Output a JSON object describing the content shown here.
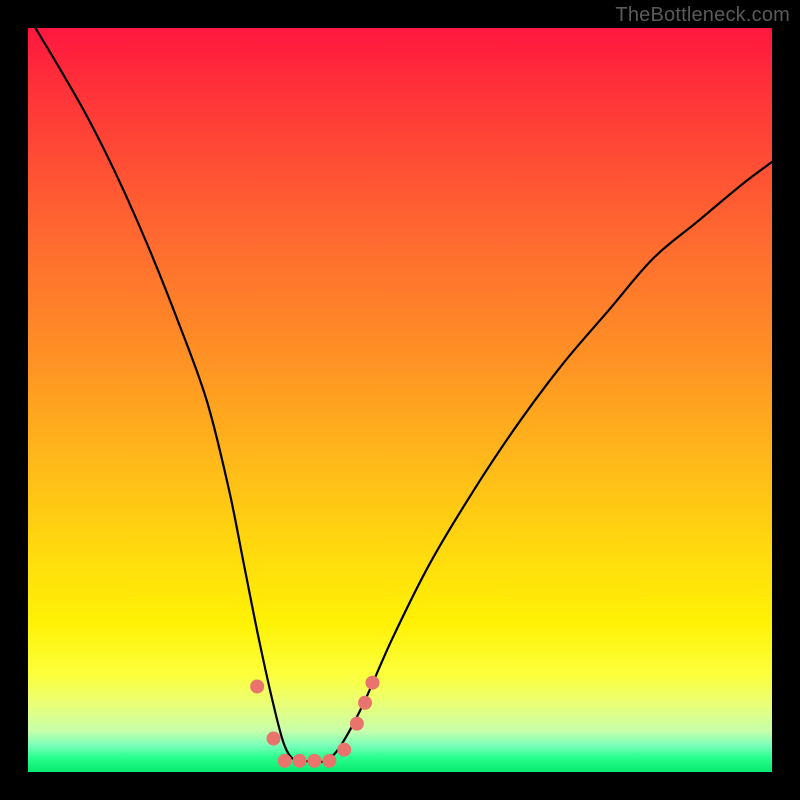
{
  "watermark": "TheBottleneck.com",
  "chart_data": {
    "type": "line",
    "title": "",
    "xlabel": "",
    "ylabel": "",
    "xlim": [
      0,
      100
    ],
    "ylim": [
      0,
      100
    ],
    "series": [
      {
        "name": "bottleneck-curve",
        "x": [
          1,
          4,
          8,
          12,
          16,
          20,
          24,
          27,
          29,
          31,
          33,
          34.5,
          36,
          38,
          40,
          42,
          45,
          49,
          54,
          60,
          66,
          72,
          78,
          84,
          90,
          96,
          100
        ],
        "values": [
          100,
          95,
          88,
          80,
          71,
          61,
          50,
          38,
          28,
          18,
          9,
          3.5,
          1.5,
          1.5,
          1.5,
          3.5,
          9,
          18,
          28,
          38,
          47,
          55,
          62,
          69,
          74,
          79,
          82
        ]
      }
    ],
    "markers": {
      "color": "#e8746d",
      "radius_px": 7,
      "points": [
        {
          "x": 30.8,
          "y": 11.5
        },
        {
          "x": 33.0,
          "y": 4.5
        },
        {
          "x": 34.5,
          "y": 1.5
        },
        {
          "x": 36.5,
          "y": 1.5
        },
        {
          "x": 38.5,
          "y": 1.5
        },
        {
          "x": 40.5,
          "y": 1.5
        },
        {
          "x": 42.5,
          "y": 3.0
        },
        {
          "x": 44.2,
          "y": 6.5
        },
        {
          "x": 45.3,
          "y": 9.3
        },
        {
          "x": 46.3,
          "y": 12.0
        }
      ]
    },
    "gradient_stops": [
      {
        "pos": 0.0,
        "color": "#ff173f"
      },
      {
        "pos": 0.07,
        "color": "#ff2e3a"
      },
      {
        "pos": 0.17,
        "color": "#ff4b35"
      },
      {
        "pos": 0.3,
        "color": "#ff6e2f"
      },
      {
        "pos": 0.45,
        "color": "#ff9324"
      },
      {
        "pos": 0.58,
        "color": "#ffb81a"
      },
      {
        "pos": 0.7,
        "color": "#ffd90e"
      },
      {
        "pos": 0.8,
        "color": "#fff205"
      },
      {
        "pos": 0.87,
        "color": "#fcff3d"
      },
      {
        "pos": 0.91,
        "color": "#e9ff79"
      },
      {
        "pos": 0.945,
        "color": "#c6ffab"
      },
      {
        "pos": 0.965,
        "color": "#77ffb8"
      },
      {
        "pos": 0.98,
        "color": "#2aff8f"
      },
      {
        "pos": 1.0,
        "color": "#08e96f"
      }
    ]
  }
}
